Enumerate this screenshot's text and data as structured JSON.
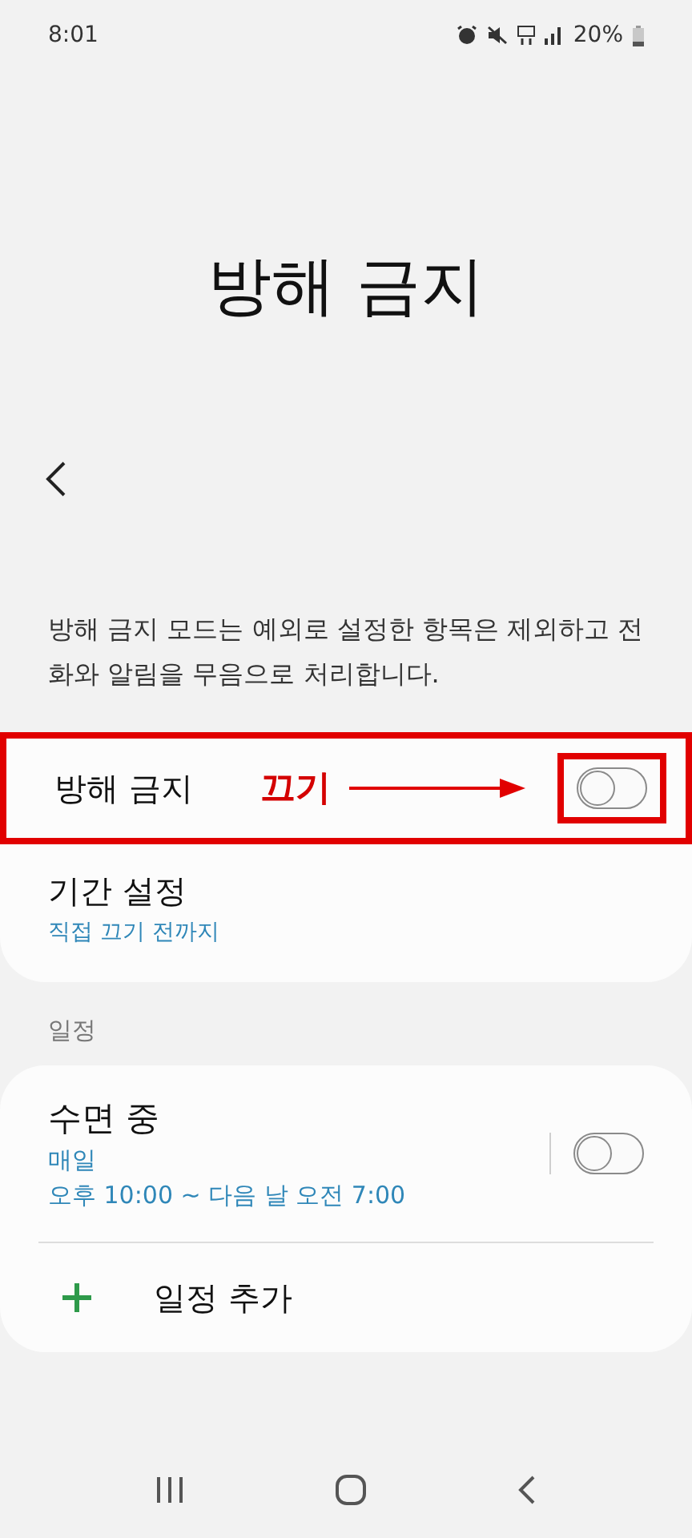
{
  "status_bar": {
    "time": "8:01",
    "battery": "20%"
  },
  "title": "방해 금지",
  "description": "방해 금지 모드는 예외로 설정한 항목은 제외하고 전화와 알림을 무음으로 처리합니다.",
  "main_card": {
    "toggle_row": {
      "label": "방해 금지",
      "on": false,
      "annotation": "끄기"
    },
    "duration": {
      "label": "기간 설정",
      "value": "직접 끄기 전까지"
    }
  },
  "schedule_section": {
    "header": "일정",
    "items": [
      {
        "title": "수면 중",
        "repeat": "매일",
        "time": "오후 10:00 ~ 다음 날 오전 7:00",
        "on": false
      }
    ],
    "add_label": "일정 추가"
  }
}
